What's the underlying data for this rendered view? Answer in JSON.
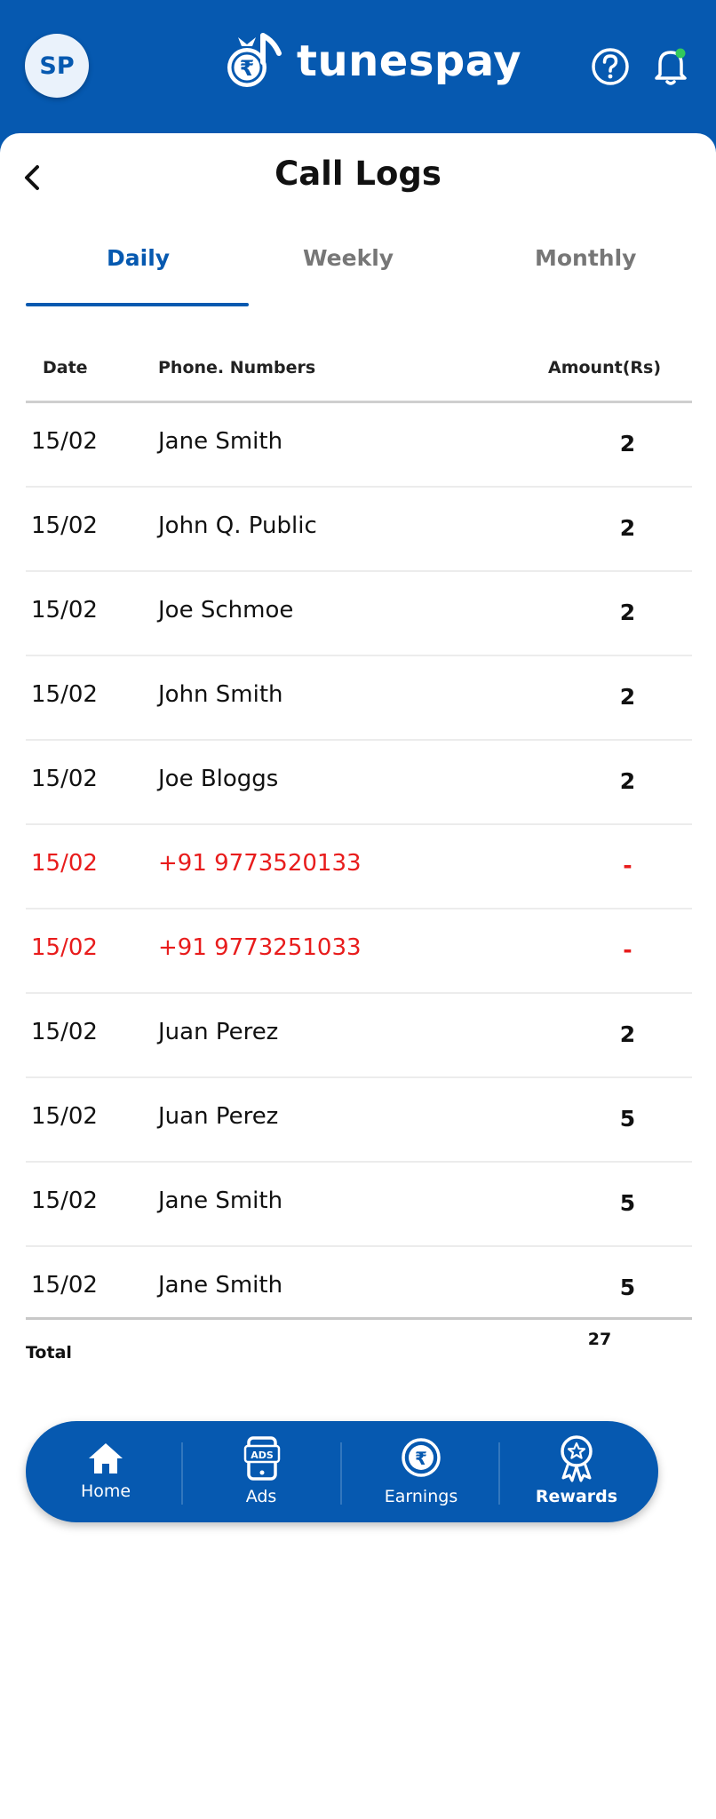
{
  "header": {
    "avatar_initials": "SP",
    "brand_name": "tunespay",
    "brand_color": "#0659b0",
    "icons": [
      "help-icon",
      "bell-icon"
    ],
    "notification_dot_color": "#32c95c"
  },
  "page": {
    "title": "Call Logs"
  },
  "tabs": [
    {
      "label": "Daily",
      "active": true
    },
    {
      "label": "Weekly",
      "active": false
    },
    {
      "label": "Monthly",
      "active": false
    }
  ],
  "table": {
    "headers": {
      "date": "Date",
      "phone": "Phone. Numbers",
      "amount": "Amount(Rs)"
    },
    "rows": [
      {
        "date": "15/02",
        "phone": "Jane Smith",
        "amount": "2",
        "missed": false
      },
      {
        "date": "15/02",
        "phone": "John Q. Public",
        "amount": "2",
        "missed": false
      },
      {
        "date": "15/02",
        "phone": "Joe Schmoe",
        "amount": "2",
        "missed": false
      },
      {
        "date": "15/02",
        "phone": "John Smith",
        "amount": "2",
        "missed": false
      },
      {
        "date": "15/02",
        "phone": "Joe Bloggs",
        "amount": "2",
        "missed": false
      },
      {
        "date": "15/02",
        "phone": "+91 9773520133",
        "amount": "-",
        "missed": true
      },
      {
        "date": "15/02",
        "phone": "+91 9773251033",
        "amount": "-",
        "missed": true
      },
      {
        "date": "15/02",
        "phone": "Juan Perez",
        "amount": "2",
        "missed": false
      },
      {
        "date": "15/02",
        "phone": "Juan Perez",
        "amount": "5",
        "missed": false
      },
      {
        "date": "15/02",
        "phone": "Jane Smith",
        "amount": "5",
        "missed": false
      },
      {
        "date": "15/02",
        "phone": "Jane Smith",
        "amount": "5",
        "missed": false
      }
    ],
    "total_label": "Total",
    "total_value": "27",
    "missed_color": "#e81c1c"
  },
  "bottom_nav": [
    {
      "label": "Home",
      "icon": "home-icon"
    },
    {
      "label": "Ads",
      "icon": "ads-icon",
      "icon_text": "ADS"
    },
    {
      "label": "Earnings",
      "icon": "rupee-coin-icon"
    },
    {
      "label": "Rewards",
      "icon": "rewards-medal-icon",
      "active": true
    }
  ]
}
